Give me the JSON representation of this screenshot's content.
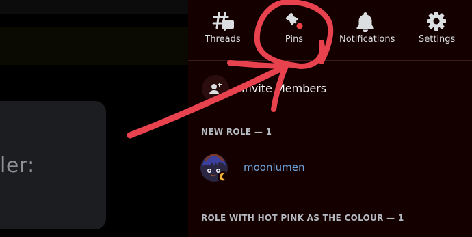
{
  "left": {
    "card_text": "ler:"
  },
  "toolbar": {
    "threads": "Threads",
    "pins": "Pins",
    "notifications": "Notifications",
    "settings": "Settings"
  },
  "invite": {
    "label": "Invite Members"
  },
  "sections": [
    {
      "title": "NEW ROLE — 1",
      "members": [
        {
          "name": "moonlumen"
        }
      ]
    },
    {
      "title": "ROLE WITH HOT PINK AS THE COLOUR — 1"
    }
  ],
  "colors": {
    "annotation": "#e8424f",
    "member_name": "#6fa2d9",
    "panel_bg": "#150000"
  },
  "icons": [
    "threads-icon",
    "pin-icon",
    "bell-icon",
    "gear-icon",
    "add-member-icon"
  ]
}
